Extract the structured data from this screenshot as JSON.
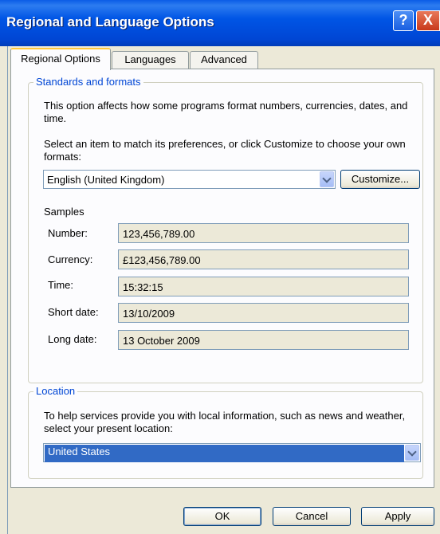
{
  "window": {
    "title": "Regional and Language Options",
    "help_label": "?",
    "close_label": "X"
  },
  "tabs": [
    {
      "label": "Regional Options",
      "active": true
    },
    {
      "label": "Languages",
      "active": false
    },
    {
      "label": "Advanced",
      "active": false
    }
  ],
  "standards": {
    "legend": "Standards and formats",
    "description": "This option affects how some programs format numbers, currencies, dates, and time.",
    "select_prompt": "Select an item to match its preferences, or click Customize to choose your own formats:",
    "selected_locale": "English (United Kingdom)",
    "customize_label": "Customize...",
    "samples_label": "Samples",
    "samples": [
      {
        "label": "Number:",
        "value": "123,456,789.00"
      },
      {
        "label": "Currency:",
        "value": "£123,456,789.00"
      },
      {
        "label": "Time:",
        "value": "15:32:15"
      },
      {
        "label": "Short date:",
        "value": "13/10/2009"
      },
      {
        "label": "Long date:",
        "value": "13 October 2009"
      }
    ]
  },
  "location": {
    "legend": "Location",
    "description": "To help services provide you with local information, such as news and weather, select your present location:",
    "selected": "United States"
  },
  "buttons": {
    "ok": "OK",
    "cancel": "Cancel",
    "apply": "Apply"
  },
  "colors": {
    "titlebar": "#0055e5",
    "accent_legend": "#0046d5",
    "selection": "#316ac5",
    "dialog_bg": "#ECE9D8"
  }
}
